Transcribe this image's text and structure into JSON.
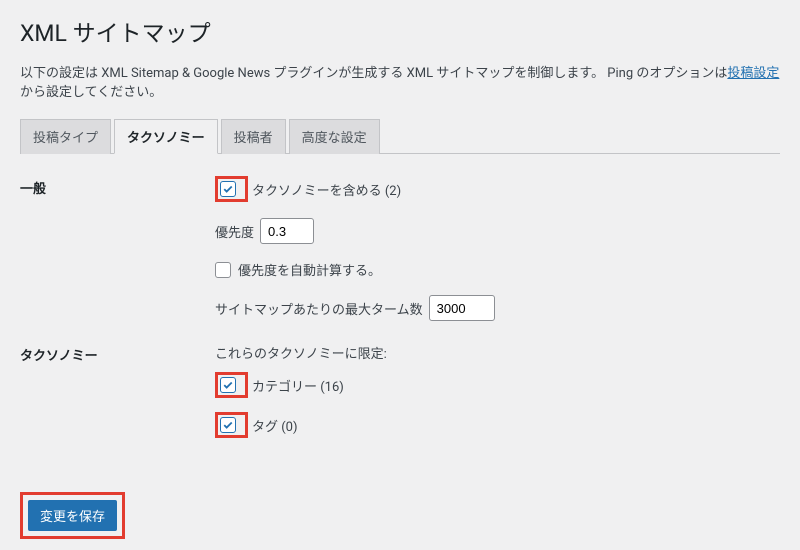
{
  "page_title": "XML サイトマップ",
  "description_prefix": "以下の設定は XML Sitemap & Google News プラグインが生成する XML サイトマップを制御します。 Ping のオプションは",
  "description_link": "投稿設定",
  "description_suffix": "から設定してください。",
  "tabs": {
    "post_types": "投稿タイプ",
    "taxonomies": "タクソノミー",
    "authors": "投稿者",
    "advanced": "高度な設定"
  },
  "sections": {
    "general": {
      "label": "一般",
      "include_taxonomies": "タクソノミーを含める (2)",
      "priority_label": "優先度",
      "priority_value": "0.3",
      "auto_priority": "優先度を自動計算する。",
      "max_terms_label": "サイトマップあたりの最大ターム数",
      "max_terms_value": "3000"
    },
    "taxonomies": {
      "label": "タクソノミー",
      "limit_label": "これらのタクソノミーに限定:",
      "category": "カテゴリー (16)",
      "tag": "タグ (0)"
    }
  },
  "save_button": "変更を保存"
}
